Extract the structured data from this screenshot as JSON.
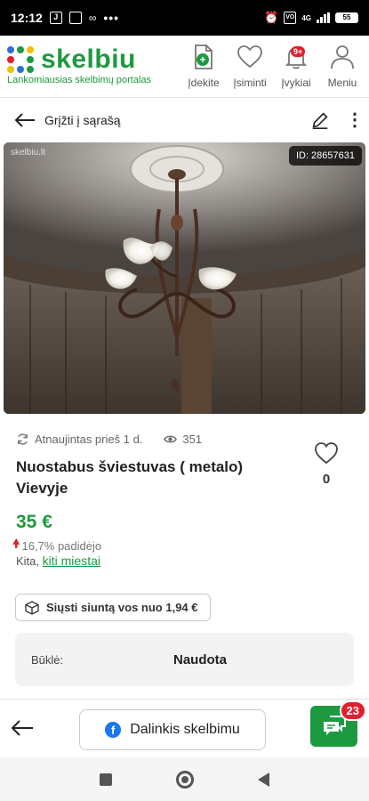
{
  "status_bar": {
    "time": "12:12",
    "dots": "•••",
    "network": "4G",
    "battery": "55"
  },
  "header": {
    "logo_text": "skelbiu",
    "tagline": "Lankomiausias skelbimų portalas",
    "logo_colors": [
      "#2f6fd0",
      "#1d9a3f",
      "#f2c200",
      "#e01f2d",
      "#2f6fd0",
      "#1d9a3f",
      "#f2c200",
      "#2f6fd0",
      "#1d9a3f"
    ],
    "nav": [
      {
        "label": "Įdekite",
        "icon": "add-document-icon"
      },
      {
        "label": "Įsiminti",
        "icon": "heart-icon"
      },
      {
        "label": "Įvykiai",
        "icon": "bell-icon",
        "badge": "9+"
      },
      {
        "label": "Meniu",
        "icon": "user-icon"
      }
    ]
  },
  "action_bar": {
    "back_label": "Grįžti į sąrašą"
  },
  "photo": {
    "watermark": "skelbiu.lt",
    "id_label": "ID: 28657631"
  },
  "listing": {
    "updated": "Atnaujintas prieš 1 d.",
    "views": "351",
    "title": "Nuostabus šviestuvas ( metalo) Vievyje",
    "favorites": "0",
    "price": "35 €",
    "price_change": "16,7% padidėjo",
    "location_prefix": "Kita,",
    "location_link": "kiti miestai",
    "shipping_label": "Siųsti siuntą vos nuo 1,94 €",
    "condition_label": "Būklė:",
    "condition_value": "Naudota"
  },
  "bottom_bar": {
    "share_label": "Dalinkis skelbimu",
    "chat_badge": "23"
  },
  "colors": {
    "brand_green": "#1d9a3f",
    "badge_red": "#e01f2d",
    "facebook_blue": "#1877f2"
  }
}
